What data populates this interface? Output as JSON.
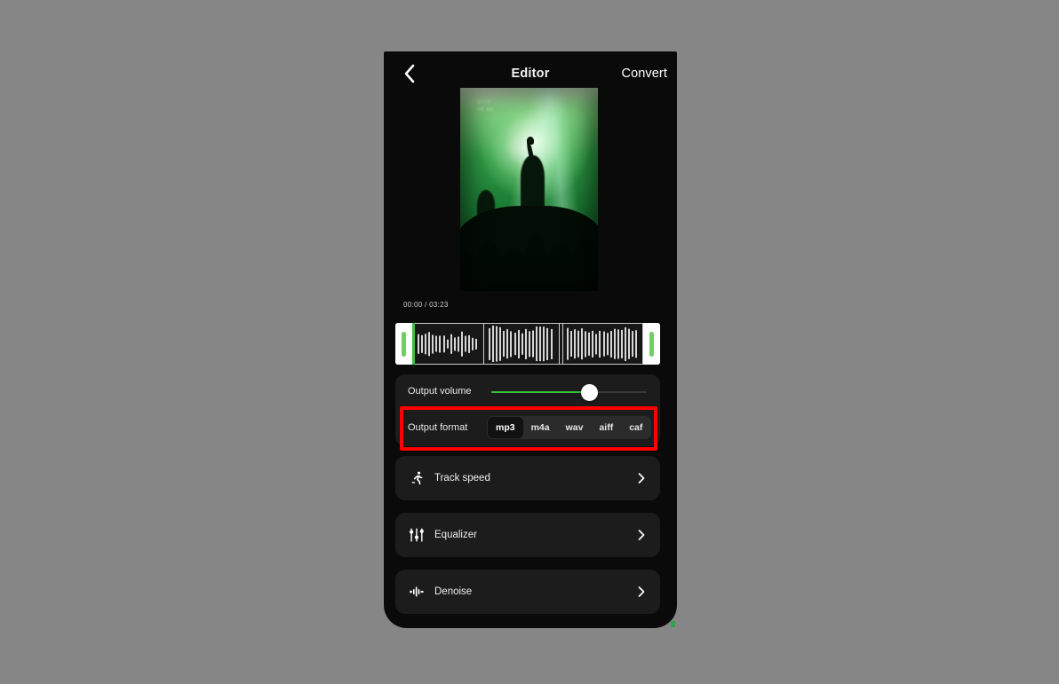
{
  "canvas": {
    "background_color": "#868686",
    "annotation_color": "#fe0000"
  },
  "header": {
    "back_icon": "chevron-left-icon",
    "title": "Editor",
    "convert_label": "Convert"
  },
  "artwork": {
    "description": "concert-photo-green",
    "watermark_line1": "gose",
    "watermark_line2": "od en"
  },
  "player": {
    "current_time": "00:00",
    "separator": "/",
    "total_time": "03:23",
    "time_display": "00:00 / 03:23"
  },
  "waveform": {
    "left_handle": "trim-handle-left",
    "right_handle": "trim-handle-right",
    "playhead_color": "#3fbf3f"
  },
  "volume": {
    "label": "Output volume",
    "value_percent": 63,
    "fill_color": "#35c13a"
  },
  "format": {
    "label": "Output format",
    "selected": "mp3",
    "options": [
      {
        "label": "mp3",
        "selected": true
      },
      {
        "label": "m4a",
        "selected": false
      },
      {
        "label": "wav",
        "selected": false
      },
      {
        "label": "aiff",
        "selected": false
      },
      {
        "label": "caf",
        "selected": false
      }
    ]
  },
  "features": [
    {
      "label": "Track speed",
      "icon": "running-person-icon",
      "chevron": "chevron-right-icon"
    },
    {
      "label": "Equalizer",
      "icon": "equalizer-sliders-icon",
      "chevron": "chevron-right-icon"
    },
    {
      "label": "Denoise",
      "icon": "denoise-waveform-icon",
      "chevron": "chevron-right-icon"
    }
  ]
}
